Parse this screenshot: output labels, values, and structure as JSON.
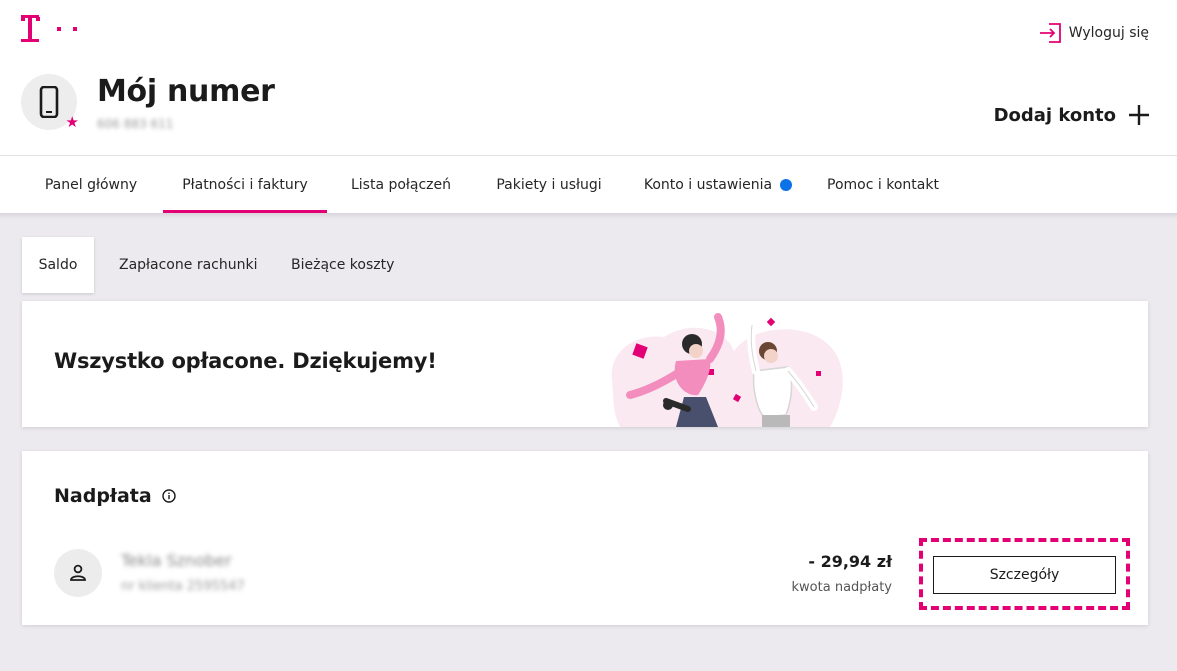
{
  "header": {
    "logout_label": "Wyloguj się",
    "title": "Mój numer",
    "phone_number": "606 883 611",
    "add_account_label": "Dodaj konto"
  },
  "nav": {
    "items": [
      {
        "label": "Panel główny"
      },
      {
        "label": "Płatności i faktury",
        "active": true
      },
      {
        "label": "Lista połączeń"
      },
      {
        "label": "Pakiety i usługi"
      },
      {
        "label": "Konto i ustawienia",
        "badge": true
      },
      {
        "label": "Pomoc i kontakt"
      }
    ]
  },
  "subtabs": {
    "items": [
      {
        "label": "Saldo",
        "active": true
      },
      {
        "label": "Zapłacone rachunki"
      },
      {
        "label": "Bieżące koszty"
      }
    ]
  },
  "status_card": {
    "message": "Wszystko opłacone. Dziękujemy!"
  },
  "overpayment": {
    "title": "Nadpłata",
    "customer_name": "Tekla Sznober",
    "customer_id": "nr klienta 2595547",
    "amount": "- 29,94 zł",
    "amount_label": "kwota nadpłaty",
    "details_button": "Szczegóły"
  },
  "colors": {
    "brand": "#e20074",
    "badge": "#0b72e7",
    "background": "#eceaef"
  },
  "icons": [
    "telekom-logo",
    "logout-icon",
    "phone-icon",
    "star-icon",
    "plus-icon",
    "info-icon",
    "person-icon"
  ]
}
